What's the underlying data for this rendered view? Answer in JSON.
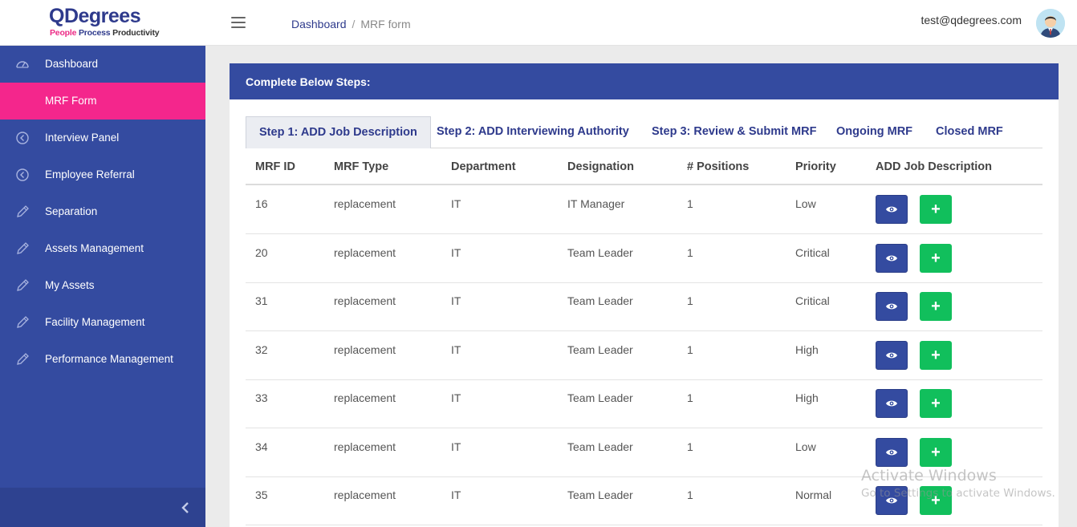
{
  "logo": {
    "main": "QDegrees",
    "tag_people": "People ",
    "tag_process": "Process ",
    "tag_productivity": "Productivity"
  },
  "header": {
    "breadcrumb": {
      "home": "Dashboard",
      "separator": "/",
      "current": "MRF form"
    },
    "user_email": "test@qdegrees.com"
  },
  "sidebar": {
    "items": [
      {
        "label": "Dashboard",
        "icon": "speedometer-icon"
      },
      {
        "label": "MRF Form",
        "icon": "",
        "active": true
      },
      {
        "label": "Interview Panel",
        "icon": "circle-arrow-icon"
      },
      {
        "label": "Employee Referral",
        "icon": "circle-arrow-icon"
      },
      {
        "label": "Separation",
        "icon": "pencil-icon"
      },
      {
        "label": "Assets Management",
        "icon": "pencil-icon"
      },
      {
        "label": "My Assets",
        "icon": "pencil-icon"
      },
      {
        "label": "Facility Management",
        "icon": "pencil-icon"
      },
      {
        "label": "Performance Management",
        "icon": "pencil-icon"
      }
    ]
  },
  "card": {
    "title": "Complete Below Steps:",
    "tabs": [
      {
        "label": "Step 1: ADD Job Description",
        "active": true
      },
      {
        "label": "Step 2: ADD Interviewing Authority"
      },
      {
        "label": "Step 3: Review & Submit MRF"
      },
      {
        "label": "Ongoing MRF"
      },
      {
        "label": "Closed MRF"
      }
    ]
  },
  "table": {
    "headers": [
      "MRF ID",
      "MRF Type",
      "Department",
      "Designation",
      "# Positions",
      "Priority",
      "ADD Job Description"
    ],
    "rows": [
      [
        "16",
        "replacement",
        "IT",
        "IT Manager",
        "1",
        "Low"
      ],
      [
        "20",
        "replacement",
        "IT",
        "Team Leader",
        "1",
        "Critical"
      ],
      [
        "31",
        "replacement",
        "IT",
        "Team Leader",
        "1",
        "Critical"
      ],
      [
        "32",
        "replacement",
        "IT",
        "Team Leader",
        "1",
        "High"
      ],
      [
        "33",
        "replacement",
        "IT",
        "Team Leader",
        "1",
        "High"
      ],
      [
        "34",
        "replacement",
        "IT",
        "Team Leader",
        "1",
        "Low"
      ],
      [
        "35",
        "replacement",
        "IT",
        "Team Leader",
        "1",
        "Normal"
      ]
    ],
    "add_symbol": "+"
  },
  "watermark": {
    "line1": "Activate Windows",
    "line2": "Go to Settings to activate Windows."
  },
  "colors": {
    "primary": "#344ba0",
    "accent": "#f4268c",
    "success": "#11bf5c"
  }
}
